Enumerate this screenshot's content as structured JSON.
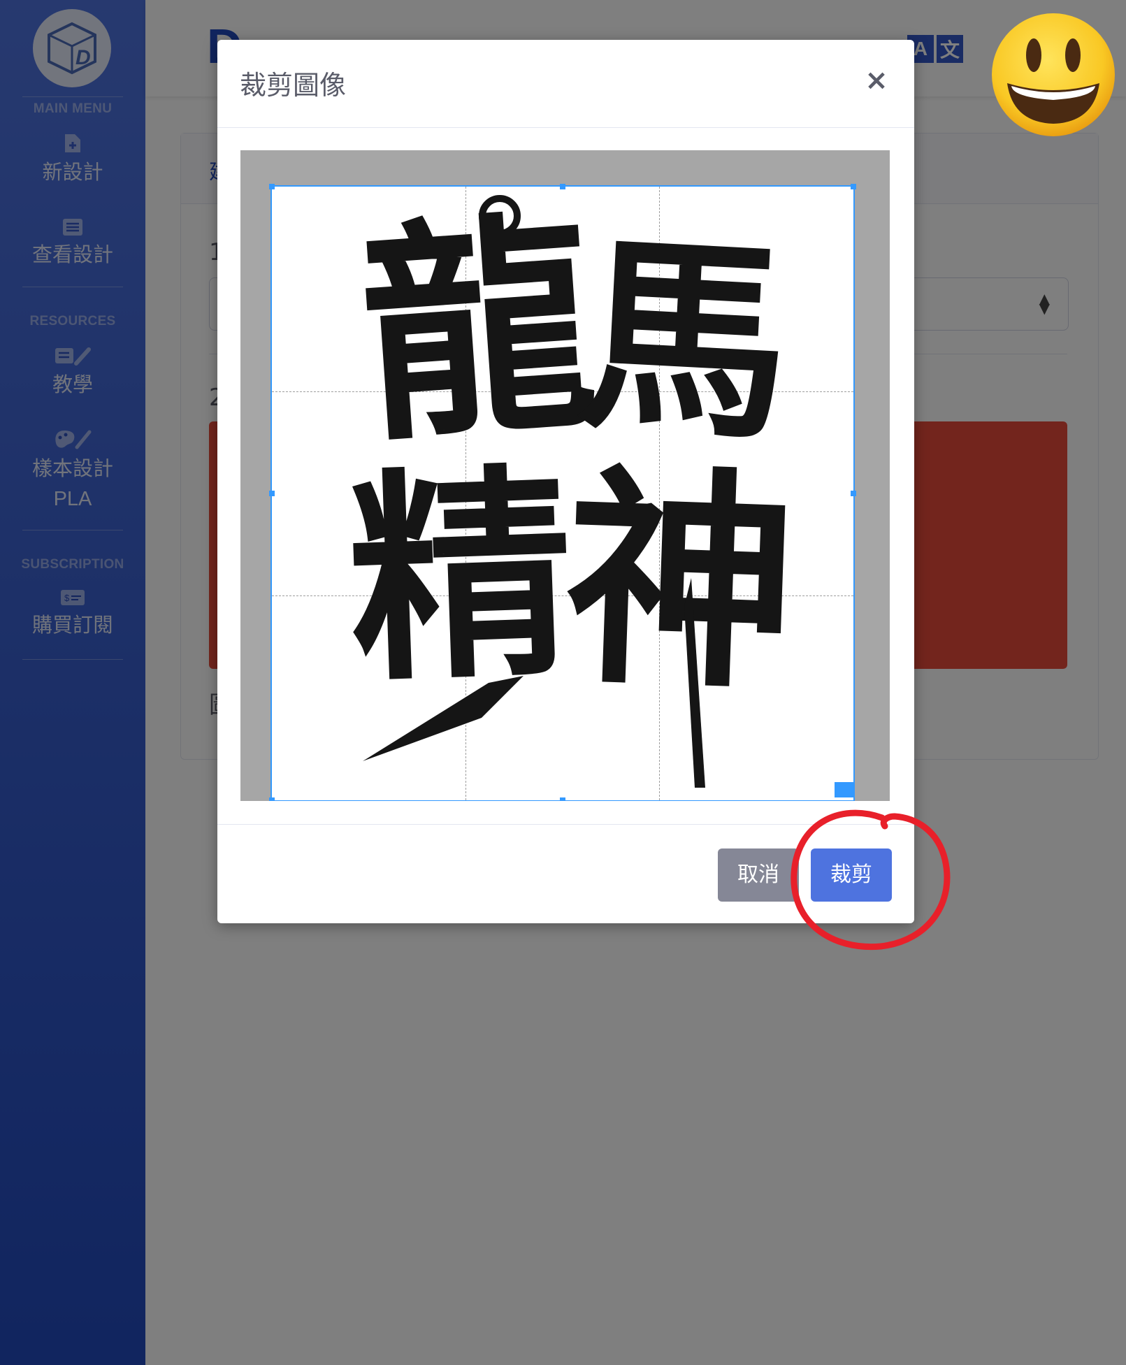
{
  "sidebar": {
    "main_menu_heading": "MAIN MENU",
    "resources_heading": "RESOURCES",
    "subscription_heading": "SUBSCRIPTION",
    "items": [
      {
        "label": "新設計",
        "icon": "file-add-icon"
      },
      {
        "label": "查看設計",
        "icon": "list-icon"
      },
      {
        "label": "教學",
        "icon": "chalkboard-teacher-icon"
      },
      {
        "label": "樣本設計",
        "sub_label": "PLA",
        "icon": "palette-brush-icon"
      },
      {
        "label": "購買訂閱",
        "icon": "money-bill-icon"
      }
    ]
  },
  "topbar": {
    "brand": "D",
    "lang_badge": [
      "A",
      "文"
    ]
  },
  "background_content": {
    "tab_label": "建",
    "step1_number": "1",
    "step2_number": "2",
    "bottom_char": "圖"
  },
  "modal": {
    "title": "裁剪圖像",
    "close_symbol": "×",
    "image_chars": [
      "龍",
      "馬",
      "精",
      "神"
    ],
    "cancel_label": "取消",
    "crop_label": "裁剪"
  },
  "colors": {
    "sidebar_top": "#4e73df",
    "sidebar_bottom": "#224abe",
    "primary_button": "#4e73df",
    "secondary_button": "#858796",
    "crop_outline": "#3399ff",
    "annotation_red": "#e8202a",
    "danger_block": "#e74a3b"
  }
}
